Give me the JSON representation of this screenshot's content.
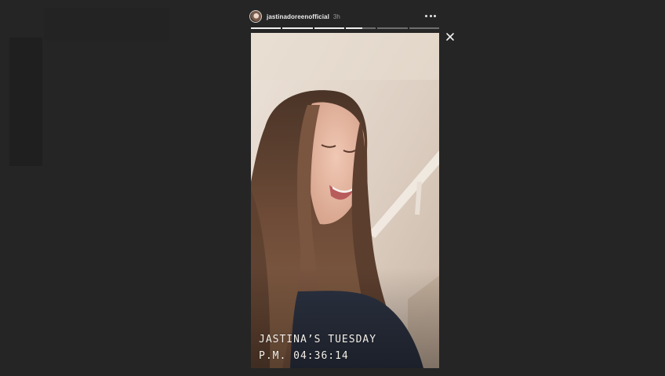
{
  "story": {
    "username": "jastinadoreenofficial",
    "timestamp": "3h",
    "segments_total": 6,
    "segments_completed": 3,
    "current_segment_progress": 0.55,
    "caption_title": "JASTINA’S TUESDAY",
    "caption_time": "P.M. 04:36:14"
  },
  "icons": {
    "more": "more-horizontal-icon",
    "close": "close-icon"
  },
  "colors": {
    "background": "#252525",
    "progress_active": "#efefef",
    "progress_inactive": "#6e6e6e"
  }
}
